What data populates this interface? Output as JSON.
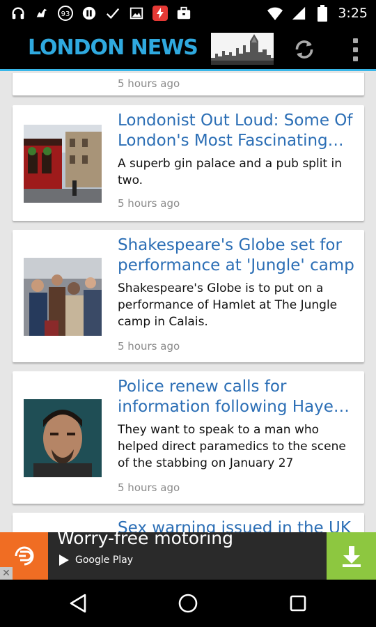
{
  "status_bar": {
    "time": "3:25",
    "notification_badge": "93",
    "icons": [
      "headphones-icon",
      "bird-icon",
      "notification-count-icon",
      "pause-icon",
      "check-icon",
      "image-icon",
      "flash-icon",
      "briefcase-icon",
      "wifi-icon",
      "signal-icon",
      "battery-icon"
    ]
  },
  "app_bar": {
    "title": "LONDON NEWS",
    "refresh_icon": "refresh-icon",
    "menu_icon": "overflow-menu-icon"
  },
  "feed": {
    "partial_top_card": {
      "time": "5 hours ago"
    },
    "articles": [
      {
        "title_lines": [
          "Londonist Out Loud: Some Of",
          "London's Most Fascinating…"
        ],
        "description": "A superb gin palace and a pub split in two.",
        "time": "5 hours ago"
      },
      {
        "title_lines": [
          "Shakespeare's Globe set for",
          "performance at 'Jungle' camp"
        ],
        "description": "Shakespeare's Globe is to put on a performance of Hamlet at The Jungle camp in Calais.",
        "time": "5 hours ago"
      },
      {
        "title_lines": [
          "Police renew calls for",
          "information following Haye…"
        ],
        "description": "They want to speak to a man who helped direct paramedics to the scene of the stabbing on January 27",
        "time": "5 hours ago"
      }
    ],
    "partial_bottom_card": {
      "title": "Sex warning issued in the UK"
    }
  },
  "ad": {
    "headline": "Worry-free motoring",
    "store_label": "Google Play",
    "close_label": "✕",
    "accent_color": "#f06d23",
    "download_color": "#8dc740"
  },
  "nav_bar": {
    "icons": [
      "back-icon",
      "home-icon",
      "recents-icon"
    ]
  },
  "colors": {
    "title_blue": "#2b6eb5",
    "brand_blue": "#2fa9df",
    "background": "#e6e6e6"
  }
}
